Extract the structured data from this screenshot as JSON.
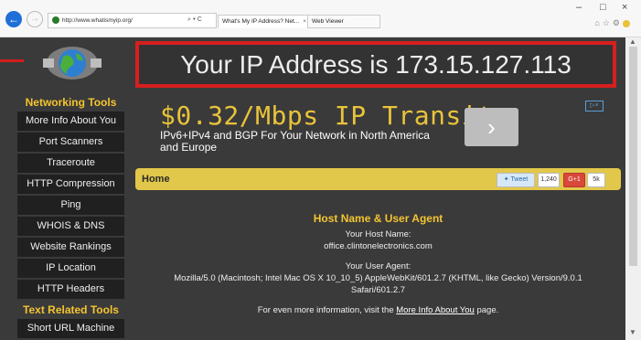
{
  "browser": {
    "address": "http://www.whatismyip.org/",
    "address_controls": "⌕ ▾ C",
    "tabs": [
      {
        "label": "What's My IP Address? Net...",
        "active": true
      },
      {
        "label": "Web Viewer",
        "active": false
      }
    ],
    "window_controls": [
      "–",
      "□",
      "×"
    ]
  },
  "banner": {
    "ip_text": "Your IP Address is 173.15.127.113"
  },
  "sidebar": {
    "sections": [
      {
        "title": "Networking Tools",
        "items": [
          "More Info About You",
          "Port Scanners",
          "Traceroute",
          "HTTP Compression",
          "Ping",
          "WHOIS & DNS",
          "Website Rankings",
          "IP Location",
          "HTTP Headers"
        ]
      },
      {
        "title": "Text Related Tools",
        "items": [
          "Short URL Machine"
        ]
      }
    ]
  },
  "ad": {
    "title": "$0.32/Mbps IP Transit",
    "subtitle": "IPv6+IPv4 and BGP For Your Network in North America and Europe",
    "button_icon": "chevron-right-icon",
    "choices_icon": "ad-choices-icon"
  },
  "homebar": {
    "label": "Home",
    "tweet_label": "Tweet",
    "tweet_count": "1,240",
    "gplus_label": "G+1",
    "gplus_count": "5k"
  },
  "main": {
    "heading": "Host Name & User Agent",
    "host_label": "Your Host Name:",
    "host_value": "office.clintonelectronics.com",
    "ua_label": "Your User Agent:",
    "ua_value_1": "Mozilla/5.0 (Macintosh; Intel Mac OS X 10_10_5) AppleWebKit/601.2.7 (KHTML, like Gecko) Version/9.0.1",
    "ua_value_2": "Safari/601.2.7",
    "more_prefix": "For even more information, visit the ",
    "more_link": "More Info About You",
    "more_suffix": " page."
  },
  "colors": {
    "accent": "#f4c430",
    "highlight_border": "#d61f1f",
    "page_bg": "#3a3a3a",
    "homebar": "#e2c84a"
  }
}
